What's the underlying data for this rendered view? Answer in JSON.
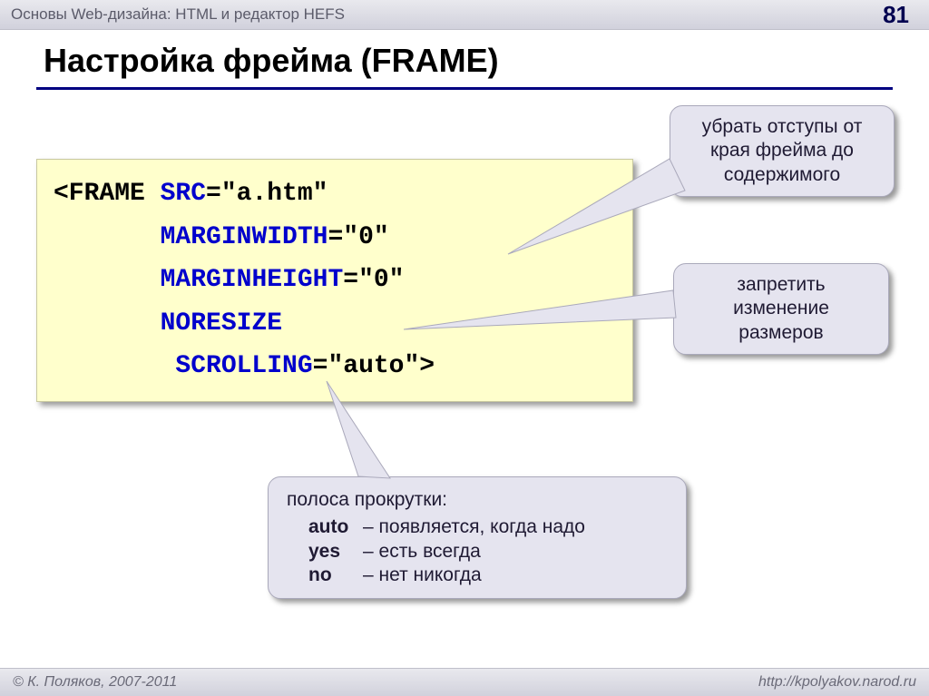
{
  "header": {
    "title": "Основы Web-дизайна: HTML и редактор HEFS",
    "page_number": "81"
  },
  "title": "Настройка фрейма (FRAME)",
  "code": {
    "l1_open": "<FRAME ",
    "l1_attr": "SRC",
    "l1_rest": "=\"a.htm\"",
    "indent": "       ",
    "l2_attr": "MARGINWIDTH",
    "l2_rest": "=\"0\"",
    "l3_attr": "MARGINHEIGHT",
    "l3_rest": "=\"0\"",
    "l4_attr": "NORESIZE",
    "indent5": "        ",
    "l5_attr": "SCROLLING",
    "l5_rest": "=\"auto\">"
  },
  "callouts": {
    "c1": "убрать отступы от края фрейма до содержимого",
    "c2": "запретить изменение размеров",
    "c3_title": "полоса прокрутки:",
    "c3_rows": [
      {
        "label": "auto",
        "desc": "– появляется, когда надо"
      },
      {
        "label": "yes",
        "desc": "– есть всегда"
      },
      {
        "label": "no",
        "desc": "– нет никогда"
      }
    ]
  },
  "footer": {
    "copyright": "© К. Поляков, 2007-2011",
    "url": "http://kpolyakov.narod.ru"
  }
}
